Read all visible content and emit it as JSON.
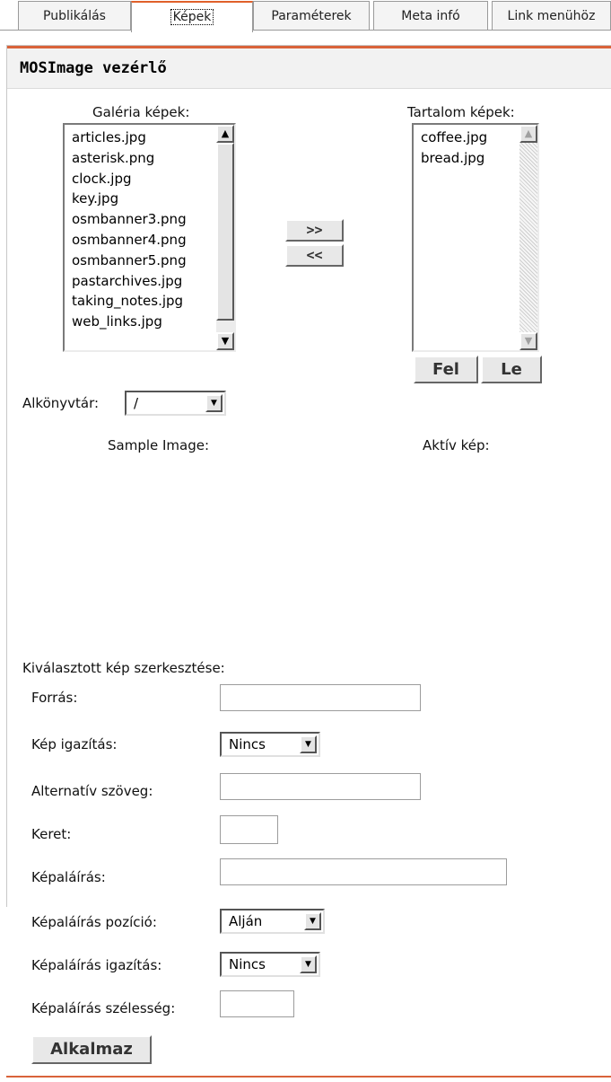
{
  "tabs": [
    "Publikálás",
    "Képek",
    "Paraméterek",
    "Meta infó",
    "Link menühöz"
  ],
  "panel_title": "MOSImage vezérlő",
  "gallery": {
    "label": "Galéria képek:",
    "items": [
      "articles.jpg",
      "asterisk.png",
      "clock.jpg",
      "key.jpg",
      "osmbanner3.png",
      "osmbanner4.png",
      "osmbanner5.png",
      "pastarchives.jpg",
      "taking_notes.jpg",
      "web_links.jpg"
    ]
  },
  "content": {
    "label": "Tartalom képek:",
    "items": [
      "coffee.jpg",
      "bread.jpg"
    ]
  },
  "buttons": {
    "add": ">>",
    "remove": "<<",
    "up": "Fel",
    "down": "Le",
    "apply": "Alkalmaz"
  },
  "subdir": {
    "label": "Alkönyvtár:",
    "value": "/"
  },
  "sample_image_label": "Sample Image:",
  "active_image_label": "Aktív kép:",
  "edit_section_label": "Kiválasztott kép szerkesztése:",
  "fields": {
    "source": {
      "label": "Forrás:",
      "value": ""
    },
    "align": {
      "label": "Kép igazítás:",
      "value": "Nincs"
    },
    "alt": {
      "label": "Alternatív szöveg:",
      "value": ""
    },
    "border": {
      "label": "Keret:",
      "value": ""
    },
    "caption": {
      "label": "Képaláírás:",
      "value": ""
    },
    "caption_position": {
      "label": "Képaláírás pozíció:",
      "value": "Alján"
    },
    "caption_align": {
      "label": "Képaláírás igazítás:",
      "value": "Nincs"
    },
    "caption_width": {
      "label": "Képaláírás szélesség:",
      "value": ""
    }
  },
  "colors": {
    "accent": "#d9633a"
  }
}
